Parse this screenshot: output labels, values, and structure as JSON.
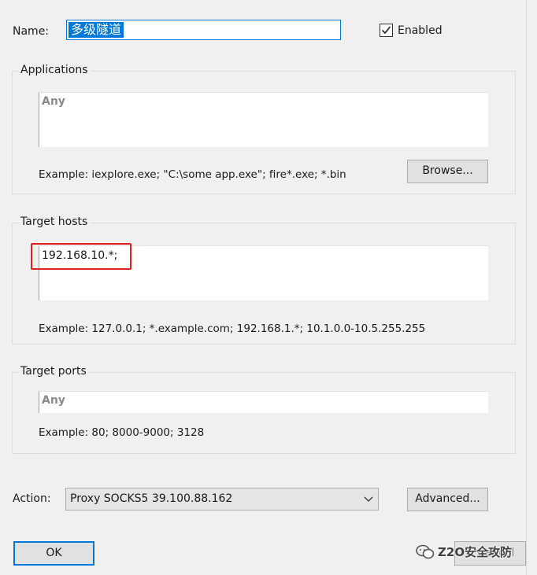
{
  "name": {
    "label": "Name:",
    "value": "多级隧道"
  },
  "enabled": {
    "label": "Enabled",
    "checked": true
  },
  "applications": {
    "legend": "Applications",
    "placeholder": "Any",
    "example": "Example: iexplore.exe; \"C:\\some app.exe\"; fire*.exe; *.bin",
    "browse_label": "Browse..."
  },
  "target_hosts": {
    "legend": "Target hosts",
    "value": "192.168.10.*;",
    "example": "Example: 127.0.0.1; *.example.com; 192.168.1.*; 10.1.0.0-10.5.255.255"
  },
  "target_ports": {
    "legend": "Target ports",
    "placeholder": "Any",
    "example": "Example: 80; 8000-9000; 3128"
  },
  "action": {
    "label": "Action:",
    "selected": "Proxy SOCKS5 39.100.88.162",
    "advanced_label": "Advanced..."
  },
  "footer": {
    "ok_label": "OK",
    "cancel_label": "Cancel",
    "watermark": "Z2O安全攻防"
  },
  "colors": {
    "selection": "#0078d7",
    "highlight_box": "#e0211d",
    "dialog_bg": "#f0f0f0"
  }
}
